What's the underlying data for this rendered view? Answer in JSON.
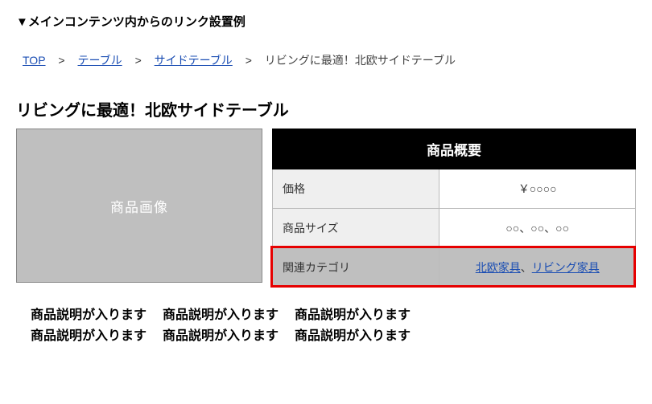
{
  "section_title": "▼メインコンテンツ内からのリンク設置例",
  "breadcrumb": {
    "items": [
      "TOP",
      "テーブル",
      "サイドテーブル"
    ],
    "current": "リビングに最適！北欧サイドテーブル",
    "sep": ">"
  },
  "product_title": "リビングに最適！北欧サイドテーブル",
  "image_placeholder": "商品画像",
  "table": {
    "header": "商品概要",
    "rows": [
      {
        "label": "価格",
        "value": "￥○○○○"
      },
      {
        "label": "商品サイズ",
        "value": "○○、○○、○○"
      }
    ],
    "highlight_row": {
      "label": "関連カテゴリ",
      "links": [
        "北欧家具",
        "リビング家具"
      ],
      "link_sep": "、"
    }
  },
  "desc": {
    "line1": "商品説明が入ります",
    "line2": "商品説明が入ります"
  }
}
